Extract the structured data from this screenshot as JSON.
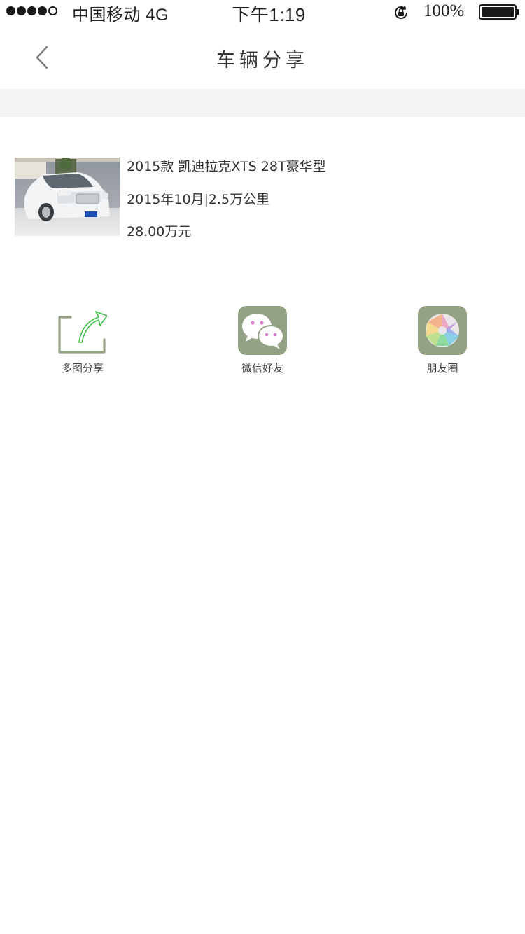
{
  "status_bar": {
    "carrier": "中国移动  4G",
    "time": "下午1:19",
    "battery": "100%"
  },
  "nav": {
    "title": "车辆分享"
  },
  "car": {
    "title": "2015款 凯迪拉克XTS 28T豪华型",
    "meta": "2015年10月|2.5万公里",
    "price": "28.00万元"
  },
  "share_options": [
    {
      "label": "多图分享",
      "icon": "share-arrow-icon"
    },
    {
      "label": "微信好友",
      "icon": "wechat-icon"
    },
    {
      "label": "朋友圈",
      "icon": "moments-icon"
    }
  ],
  "colors": {
    "accent_green": "#93a185",
    "separator": "#f4f3f4",
    "text": "#333333"
  }
}
